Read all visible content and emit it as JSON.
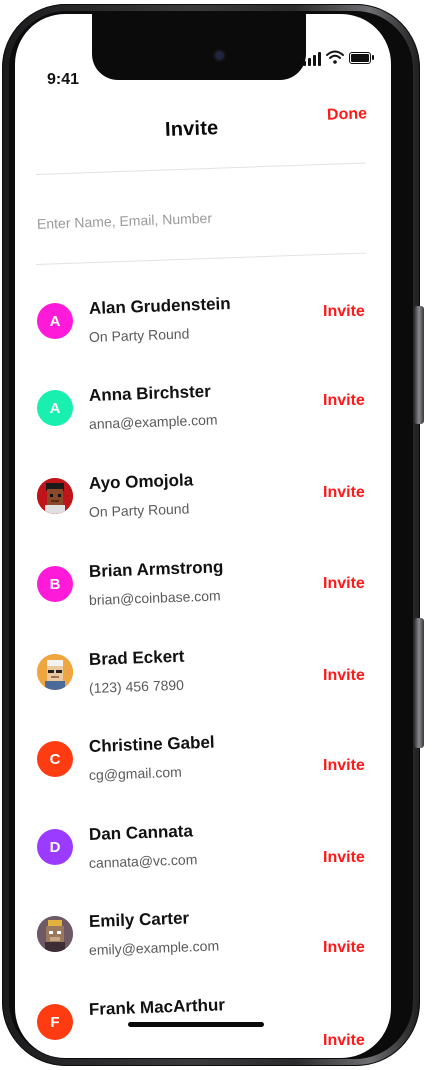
{
  "status": {
    "time": "9:41"
  },
  "header": {
    "title": "Invite",
    "done_label": "Done"
  },
  "search": {
    "placeholder": "Enter Name, Email, Number"
  },
  "colors": {
    "accent": "#ff1a1a"
  },
  "contacts": [
    {
      "name": "Alan Grudenstein",
      "detail": "On Party Round",
      "avatar_letter": "A",
      "avatar_color": "#ff19d8",
      "avatar_kind": "letter",
      "action": "Invite"
    },
    {
      "name": "Anna Birchster",
      "detail": "anna@example.com",
      "avatar_letter": "A",
      "avatar_color": "#19f0b0",
      "avatar_kind": "letter",
      "action": "Invite"
    },
    {
      "name": "Ayo Omojola",
      "detail": "On Party Round",
      "avatar_letter": "",
      "avatar_color": "#c0141a",
      "avatar_kind": "pixel-portrait",
      "action": "Invite"
    },
    {
      "name": "Brian Armstrong",
      "detail": "brian@coinbase.com",
      "avatar_letter": "B",
      "avatar_color": "#ff19d8",
      "avatar_kind": "letter",
      "action": "Invite"
    },
    {
      "name": "Brad Eckert",
      "detail": "(123) 456 7890",
      "avatar_letter": "",
      "avatar_color": "#f0a640",
      "avatar_kind": "pixel-portrait",
      "action": "Invite"
    },
    {
      "name": "Christine Gabel",
      "detail": "cg@gmail.com",
      "avatar_letter": "C",
      "avatar_color": "#ff3b12",
      "avatar_kind": "letter",
      "action": "Invite"
    },
    {
      "name": "Dan Cannata",
      "detail": "cannata@vc.com",
      "avatar_letter": "D",
      "avatar_color": "#9b3bff",
      "avatar_kind": "letter",
      "action": "Invite"
    },
    {
      "name": "Emily Carter",
      "detail": "emily@example.com",
      "avatar_letter": "",
      "avatar_color": "#6e5a66",
      "avatar_kind": "ape-portrait",
      "action": "Invite"
    },
    {
      "name": "Frank MacArthur",
      "detail": "",
      "avatar_letter": "F",
      "avatar_color": "#ff3b12",
      "avatar_kind": "letter",
      "action": "Invite"
    }
  ]
}
